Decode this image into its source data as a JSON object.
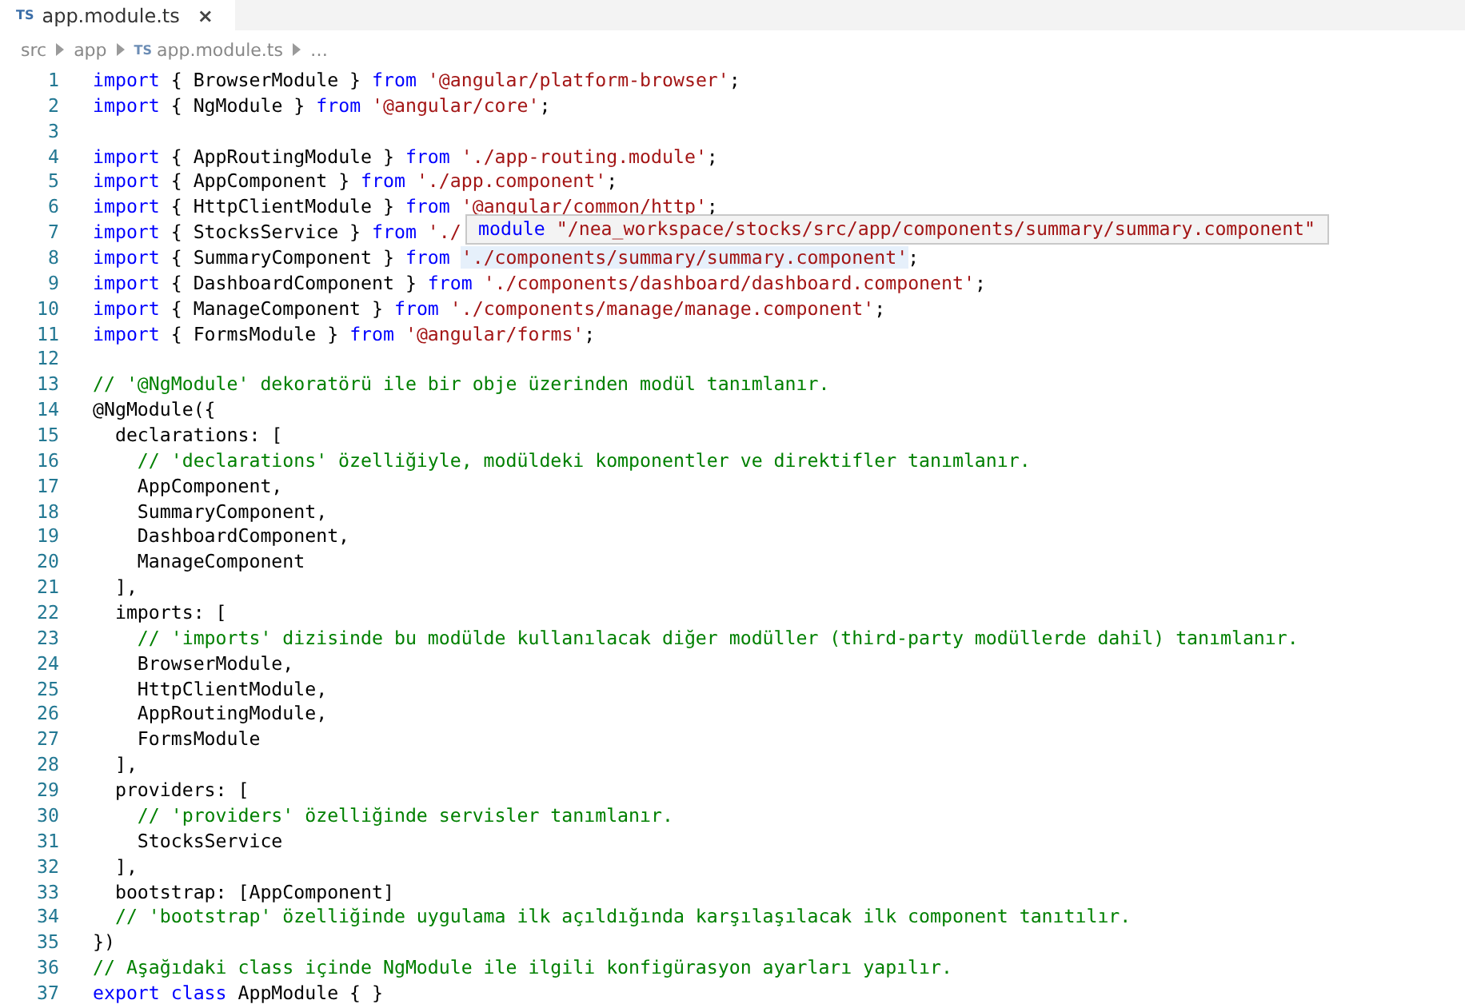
{
  "tabs": [
    {
      "badge": "TS",
      "label": "app.module.ts",
      "close": "×",
      "selected": true
    }
  ],
  "breadcrumbs": [
    {
      "label": "src"
    },
    {
      "label": "app"
    },
    {
      "badge": "TS",
      "label": "app.module.ts"
    },
    {
      "label": "…"
    }
  ],
  "lines": [
    {
      "number": "1",
      "tokens": [
        {
          "kind": "keyword",
          "text": "import"
        },
        {
          "kind": "plain",
          "text": " { BrowserModule } "
        },
        {
          "kind": "keyword",
          "text": "from "
        },
        {
          "kind": "string",
          "text": "'@angular/platform-browser'"
        },
        {
          "kind": "plain",
          "text": ";"
        }
      ]
    },
    {
      "number": "2",
      "tokens": [
        {
          "kind": "keyword",
          "text": "import"
        },
        {
          "kind": "plain",
          "text": " { NgModule } "
        },
        {
          "kind": "keyword",
          "text": "from "
        },
        {
          "kind": "string",
          "text": "'@angular/core'"
        },
        {
          "kind": "plain",
          "text": ";"
        }
      ]
    },
    {
      "number": "3"
    },
    {
      "number": "4",
      "tokens": [
        {
          "kind": "keyword",
          "text": "import"
        },
        {
          "kind": "plain",
          "text": " { AppRoutingModule } "
        },
        {
          "kind": "keyword",
          "text": "from "
        },
        {
          "kind": "string",
          "text": "'./app-routing.module'"
        },
        {
          "kind": "plain",
          "text": ";"
        }
      ]
    },
    {
      "number": "5",
      "tokens": [
        {
          "kind": "keyword",
          "text": "import"
        },
        {
          "kind": "plain",
          "text": " { AppComponent } "
        },
        {
          "kind": "keyword",
          "text": "from "
        },
        {
          "kind": "string",
          "text": "'./app.component'"
        },
        {
          "kind": "plain",
          "text": ";"
        }
      ]
    },
    {
      "number": "6",
      "tokens": [
        {
          "kind": "keyword",
          "text": "import"
        },
        {
          "kind": "plain",
          "text": " { HttpClientModule } "
        },
        {
          "kind": "keyword",
          "text": "from "
        },
        {
          "kind": "string",
          "text": "'@angular/common/http'"
        },
        {
          "kind": "plain",
          "text": ";"
        }
      ]
    },
    {
      "number": "7",
      "tokens": [
        {
          "kind": "keyword",
          "text": "import"
        },
        {
          "kind": "plain",
          "text": " { StocksService } "
        },
        {
          "kind": "keyword",
          "text": "from "
        },
        {
          "kind": "string",
          "text": "'./"
        }
      ],
      "hover_tooltip": [
        {
          "kind": "keyword",
          "text": "module "
        },
        {
          "kind": "string",
          "text": "\"/nea_workspace/stocks/src/app/components/summary/summary.component\""
        }
      ]
    },
    {
      "number": "8",
      "tokens": [
        {
          "kind": "keyword",
          "text": "import"
        },
        {
          "kind": "plain",
          "text": " { SummaryComponent } "
        },
        {
          "kind": "keyword",
          "text": "from "
        },
        {
          "kind": "string",
          "text": "'./components/summary/summary.component'",
          "highlighted": true
        },
        {
          "kind": "plain",
          "text": ";"
        }
      ]
    },
    {
      "number": "9",
      "tokens": [
        {
          "kind": "keyword",
          "text": "import"
        },
        {
          "kind": "plain",
          "text": " { DashboardComponent } "
        },
        {
          "kind": "keyword",
          "text": "from "
        },
        {
          "kind": "string",
          "text": "'./components/dashboard/dashboard.component'"
        },
        {
          "kind": "plain",
          "text": ";"
        }
      ]
    },
    {
      "number": "10",
      "tokens": [
        {
          "kind": "keyword",
          "text": "import"
        },
        {
          "kind": "plain",
          "text": " { ManageComponent } "
        },
        {
          "kind": "keyword",
          "text": "from "
        },
        {
          "kind": "string",
          "text": "'./components/manage/manage.component'"
        },
        {
          "kind": "plain",
          "text": ";"
        }
      ]
    },
    {
      "number": "11",
      "tokens": [
        {
          "kind": "keyword",
          "text": "import"
        },
        {
          "kind": "plain",
          "text": " { FormsModule } "
        },
        {
          "kind": "keyword",
          "text": "from "
        },
        {
          "kind": "string",
          "text": "'@angular/forms'"
        },
        {
          "kind": "plain",
          "text": ";"
        }
      ]
    },
    {
      "number": "12"
    },
    {
      "number": "13",
      "tokens": [
        {
          "kind": "comment",
          "text": "// '@NgModule' dekoratörü ile bir obje üzerinden modül tanımlanır."
        }
      ]
    },
    {
      "number": "14",
      "tokens": [
        {
          "kind": "plain",
          "text": "@NgModule({"
        }
      ]
    },
    {
      "number": "15",
      "tokens": [
        {
          "kind": "plain",
          "text": "  declarations: ["
        }
      ]
    },
    {
      "number": "16",
      "tokens": [
        {
          "kind": "comment",
          "text": "    // 'declarations' özelliğiyle, modüldeki komponentler ve direktifler tanımlanır."
        }
      ]
    },
    {
      "number": "17",
      "tokens": [
        {
          "kind": "plain",
          "text": "    AppComponent,"
        }
      ]
    },
    {
      "number": "18",
      "tokens": [
        {
          "kind": "plain",
          "text": "    SummaryComponent,"
        }
      ]
    },
    {
      "number": "19",
      "tokens": [
        {
          "kind": "plain",
          "text": "    DashboardComponent,"
        }
      ]
    },
    {
      "number": "20",
      "tokens": [
        {
          "kind": "plain",
          "text": "    ManageComponent"
        }
      ]
    },
    {
      "number": "21",
      "tokens": [
        {
          "kind": "plain",
          "text": "  ],"
        }
      ]
    },
    {
      "number": "22",
      "tokens": [
        {
          "kind": "plain",
          "text": "  imports: ["
        }
      ]
    },
    {
      "number": "23",
      "tokens": [
        {
          "kind": "comment",
          "text": "    // 'imports' dizisinde bu modülde kullanılacak diğer modüller (third-party modüllerde dahil) tanımlanır."
        }
      ]
    },
    {
      "number": "24",
      "tokens": [
        {
          "kind": "plain",
          "text": "    BrowserModule,"
        }
      ]
    },
    {
      "number": "25",
      "tokens": [
        {
          "kind": "plain",
          "text": "    HttpClientModule,"
        }
      ]
    },
    {
      "number": "26",
      "tokens": [
        {
          "kind": "plain",
          "text": "    AppRoutingModule,"
        }
      ]
    },
    {
      "number": "27",
      "tokens": [
        {
          "kind": "plain",
          "text": "    FormsModule"
        }
      ]
    },
    {
      "number": "28",
      "tokens": [
        {
          "kind": "plain",
          "text": "  ],"
        }
      ]
    },
    {
      "number": "29",
      "tokens": [
        {
          "kind": "plain",
          "text": "  providers: ["
        }
      ]
    },
    {
      "number": "30",
      "tokens": [
        {
          "kind": "comment",
          "text": "    // 'providers' özelliğinde servisler tanımlanır."
        }
      ]
    },
    {
      "number": "31",
      "tokens": [
        {
          "kind": "plain",
          "text": "    StocksService"
        }
      ]
    },
    {
      "number": "32",
      "tokens": [
        {
          "kind": "plain",
          "text": "  ],"
        }
      ]
    },
    {
      "number": "33",
      "tokens": [
        {
          "kind": "plain",
          "text": "  bootstrap: [AppComponent]"
        }
      ]
    },
    {
      "number": "34",
      "tokens": [
        {
          "kind": "comment",
          "text": "  // 'bootstrap' özelliğinde uygulama ilk açıldığında karşılaşılacak ilk component tanıtılır."
        }
      ]
    },
    {
      "number": "35",
      "tokens": [
        {
          "kind": "plain",
          "text": "})"
        }
      ]
    },
    {
      "number": "36",
      "tokens": [
        {
          "kind": "comment",
          "text": "// Aşağıdaki class içinde NgModule ile ilgili konfigürasyon ayarları yapılır."
        }
      ]
    },
    {
      "number": "37",
      "tokens": [
        {
          "kind": "keyword",
          "text": "export class"
        },
        {
          "kind": "plain",
          "text": " AppModule { }"
        }
      ]
    }
  ]
}
